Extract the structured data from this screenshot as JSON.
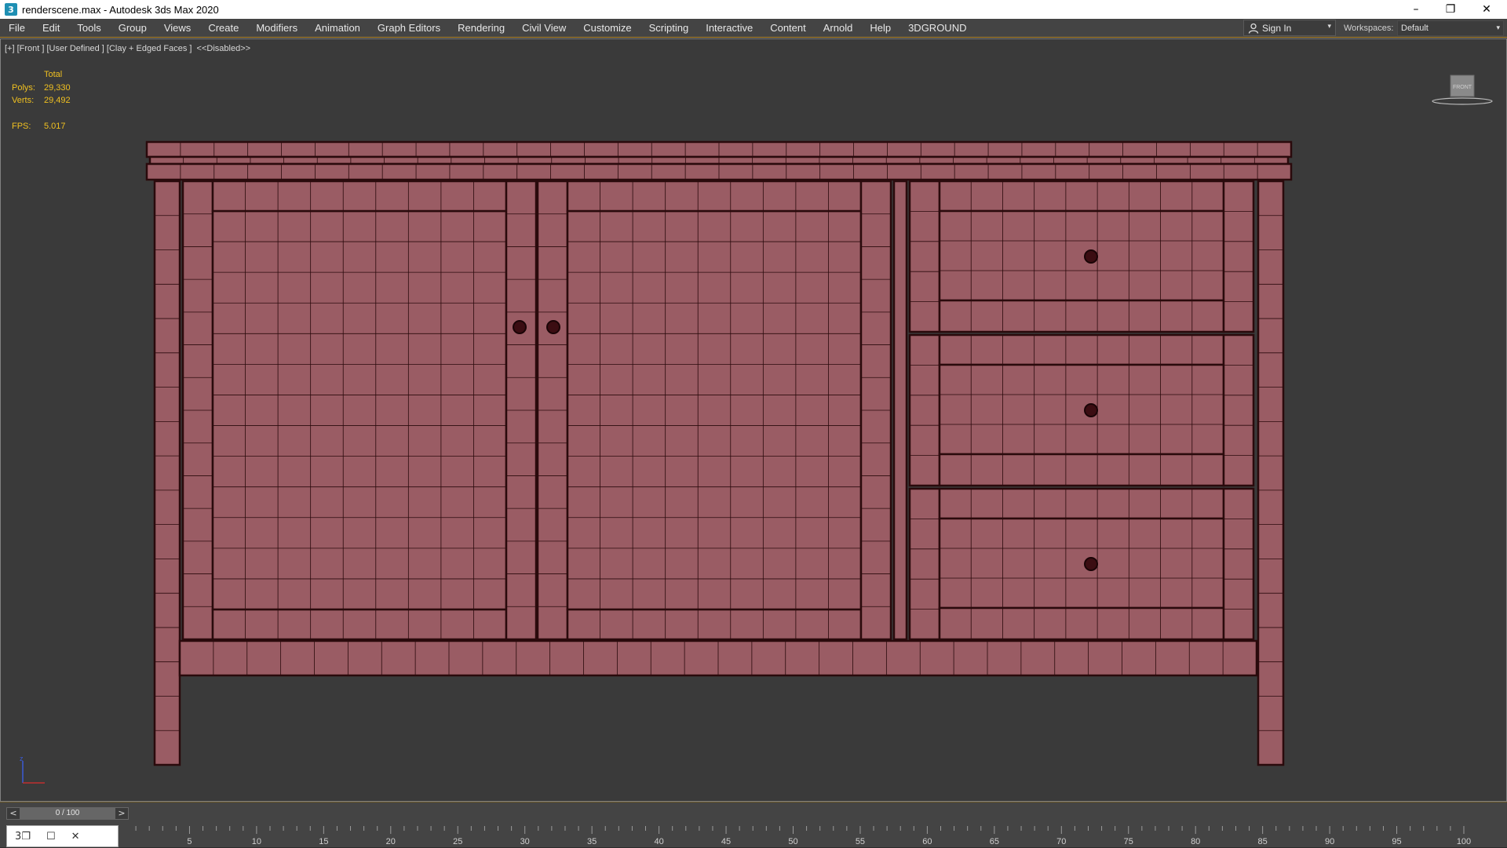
{
  "window": {
    "title": "renderscene.max - Autodesk 3ds Max 2020",
    "app_icon": "3",
    "minimize": "–",
    "restore": "❐",
    "close": "✕"
  },
  "menu": [
    "File",
    "Edit",
    "Tools",
    "Group",
    "Views",
    "Create",
    "Modifiers",
    "Animation",
    "Graph Editors",
    "Rendering",
    "Civil View",
    "Customize",
    "Scripting",
    "Interactive",
    "Content",
    "Arnold",
    "Help",
    "3DGROUND"
  ],
  "account": {
    "sign_in": "Sign In",
    "dropdown": "▾"
  },
  "workspaces": {
    "label": "Workspaces:",
    "value": "Default",
    "dropdown": "▾"
  },
  "viewport": {
    "label": "[+] [Front ] [User Defined ] [Clay + Edged Faces ]  <<Disabled>>",
    "stats": {
      "header": "Total",
      "polys_label": "Polys:",
      "polys_value": "29,330",
      "verts_label": "Verts:",
      "verts_value": "29,492",
      "fps_label": "FPS:",
      "fps_value": "5.017"
    },
    "viewcube_label": "FRONT",
    "axis_label": "z",
    "model_color": "#9a5c64",
    "edge_color": "#2a0a0c",
    "knob_color": "#3b0d12"
  },
  "timeline": {
    "frame_display": "0 / 100",
    "prev": "<",
    "next": ">",
    "tick_labels": [
      "5",
      "10",
      "15",
      "20",
      "25",
      "30",
      "35",
      "40",
      "45",
      "50",
      "55",
      "60",
      "65",
      "70",
      "75",
      "80",
      "85",
      "90",
      "95",
      "100"
    ]
  },
  "taskbar_mini": {
    "icon1": "3❐",
    "icon2": "☐",
    "icon3": "✕"
  }
}
